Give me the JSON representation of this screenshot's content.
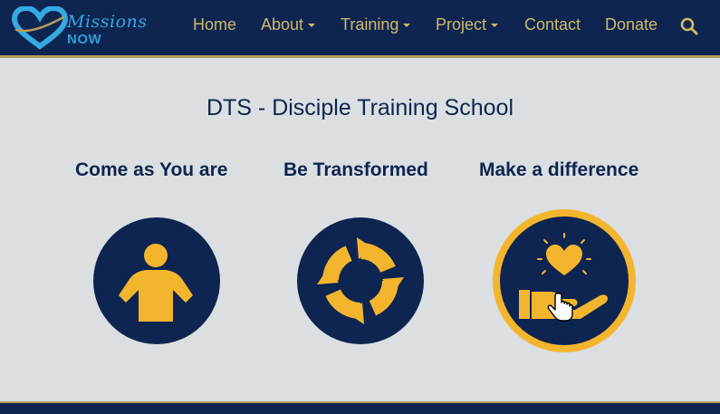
{
  "brand": {
    "script": "Missions",
    "word": "NOW",
    "colors": {
      "navy": "#0d2550",
      "gold": "#f4b52e",
      "nav_text": "#d3b866",
      "logo_blue": "#35a9e0"
    }
  },
  "nav": {
    "items": [
      {
        "label": "Home"
      },
      {
        "label": "About",
        "dropdown": true
      },
      {
        "label": "Training",
        "dropdown": true
      },
      {
        "label": "Project",
        "dropdown": true
      },
      {
        "label": "Contact"
      },
      {
        "label": "Donate"
      }
    ],
    "search_icon": "search-icon"
  },
  "main": {
    "title": "DTS - Disciple Training School",
    "features": [
      {
        "title": "Come as You are",
        "icon": "person-icon"
      },
      {
        "title": "Be Transformed",
        "icon": "cycle-arrows-icon"
      },
      {
        "title": "Make a difference",
        "icon": "hand-heart-icon",
        "hovered": true
      }
    ]
  }
}
